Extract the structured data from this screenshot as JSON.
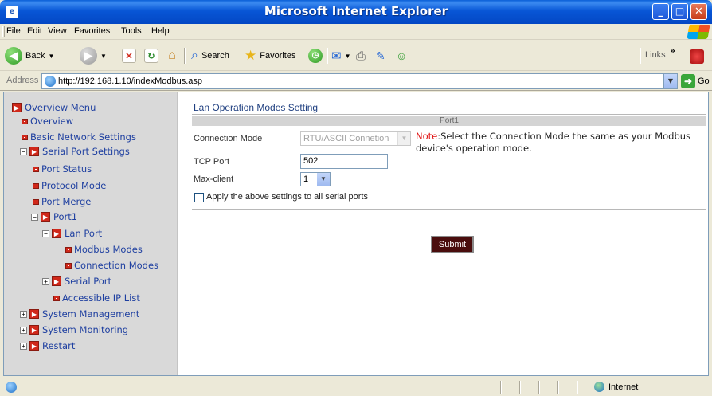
{
  "window": {
    "title": "Microsoft Internet Explorer"
  },
  "menu": [
    "File",
    "Edit",
    "View",
    "Favorites",
    "Tools",
    "Help"
  ],
  "toolbar": {
    "back": "Back",
    "search": "Search",
    "favorites": "Favorites",
    "links": "Links",
    "chevron": "»"
  },
  "address": {
    "label": "Address",
    "url": "http://192.168.1.10/indexModbus.asp",
    "go": "Go"
  },
  "sidebar": {
    "items": [
      {
        "label": "Overview Menu"
      },
      {
        "label": "Overview"
      },
      {
        "label": "Basic Network Settings"
      },
      {
        "label": "Serial Port Settings"
      },
      {
        "label": "Port Status"
      },
      {
        "label": "Protocol Mode"
      },
      {
        "label": "Port Merge"
      },
      {
        "label": "Port1"
      },
      {
        "label": "Lan Port"
      },
      {
        "label": "Modbus Modes"
      },
      {
        "label": "Connection Modes"
      },
      {
        "label": "Serial Port"
      },
      {
        "label": "Accessible IP List"
      },
      {
        "label": "System Management"
      },
      {
        "label": "System Monitoring"
      },
      {
        "label": "Restart"
      }
    ]
  },
  "main": {
    "title": "Lan Operation Modes Setting",
    "port_header": "Port1",
    "connection_mode_label": "Connection Mode",
    "connection_mode_value": "RTU/ASCII Connetion",
    "note_prefix": "Note",
    "note_text": ":Select the Connection Mode the same as your Modbus device's operation mode.",
    "tcp_port_label": "TCP Port",
    "tcp_port_value": "502",
    "max_client_label": "Max-client",
    "max_client_value": "1",
    "apply_all_label": "Apply the above settings to all serial ports",
    "submit_label": "Submit"
  },
  "status": {
    "zone": "Internet"
  }
}
